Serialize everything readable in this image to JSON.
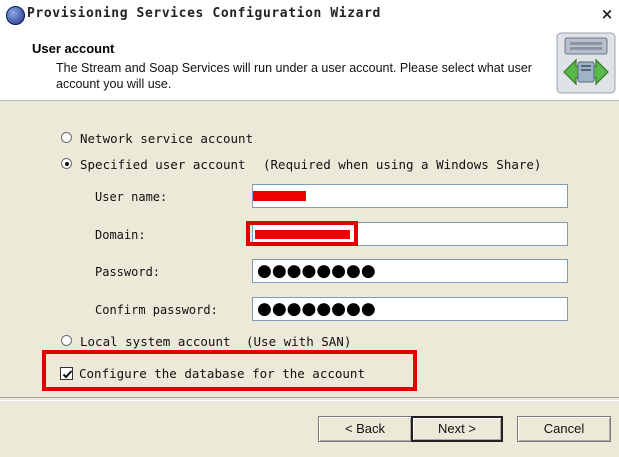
{
  "window": {
    "title": "Provisioning Services Configuration Wizard",
    "close_glyph": "×"
  },
  "header": {
    "title": "User account",
    "description": "The Stream and Soap Services will run under a user account. Please select what user account you will use.",
    "icon": "server-network-icon"
  },
  "options": {
    "network_service": "Network service account",
    "specified_user": "Specified user account",
    "specified_user_note": "(Required when using a Windows Share)",
    "local_system": "Local system account",
    "local_system_note": "(Use with SAN)",
    "selected": "specified_user"
  },
  "fields": {
    "username_label": "User name:",
    "domain_label": "Domain:",
    "password_label": "Password:",
    "confirm_label": "Confirm password:",
    "password_value": "●●●●●●●●",
    "confirm_value": "●●●●●●●●"
  },
  "configure_db": {
    "label": "Configure the database for the account",
    "checked": true
  },
  "buttons": {
    "back": "< Back",
    "next": "Next >",
    "cancel": "Cancel"
  },
  "colors": {
    "highlight_red": "#e00000",
    "dialog_bg": "#ece9d8"
  }
}
